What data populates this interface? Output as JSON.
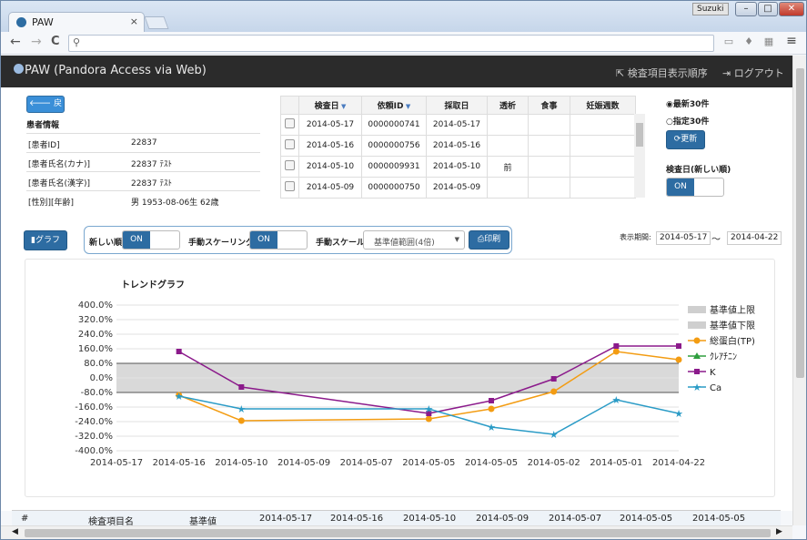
{
  "browser": {
    "tab_title": "PAW",
    "user": "Suzuki",
    "new_tab": "",
    "min": "–",
    "max": "□",
    "close": "✕",
    "tab_close": "×"
  },
  "toolbar": {
    "back": "←",
    "forward": "→",
    "reload": "C",
    "url": "",
    "menu": "≡"
  },
  "app": {
    "title": "PAW (Pandora Access via Web)",
    "order_link": "検査項目表示順序",
    "logout": "ログアウト"
  },
  "patient": {
    "back_label": "戻る",
    "heading": "患者情報",
    "rows": [
      {
        "k": "[患者ID]",
        "v": "22837"
      },
      {
        "k": "[患者氏名(カナ)]",
        "v": "22837 ﾃｽﾄ"
      },
      {
        "k": "[患者氏名(漢字)]",
        "v": "22837 ﾃｽﾄ"
      },
      {
        "k": "[性別][年齢]",
        "v": "男 1953-08-06生 62歳"
      }
    ]
  },
  "results": {
    "headers": [
      "",
      "検査日",
      "依頼ID",
      "採取日",
      "透析",
      "食事",
      "妊娠週数"
    ],
    "rows": [
      [
        "",
        "2014-05-17",
        "0000000741",
        "2014-05-17",
        "",
        "",
        ""
      ],
      [
        "",
        "2014-05-16",
        "0000000756",
        "2014-05-16",
        "",
        "",
        ""
      ],
      [
        "",
        "2014-05-10",
        "0000009931",
        "2014-05-10",
        "前",
        "",
        ""
      ],
      [
        "",
        "2014-05-09",
        "0000000750",
        "2014-05-09",
        "",
        "",
        ""
      ]
    ]
  },
  "side": {
    "radio_latest": "最新30件",
    "radio_range": "指定30件",
    "update": "更新",
    "sort_label": "検査日(新しい順)",
    "on": "ON"
  },
  "controls": {
    "graph_btn": "グラフ",
    "newest_first": "新しい順",
    "manual_scaling": "手動スケーリング",
    "manual_scale": "手動スケール",
    "scale_value": "基準値範囲(4倍)",
    "print": "印刷",
    "on": "ON",
    "period_label": "表示期間:",
    "period_from": "2014-05-17",
    "period_sep": "〜",
    "period_to": "2014-04-22"
  },
  "chart_data": {
    "type": "line",
    "title": "トレンドグラフ",
    "categories": [
      "2014-05-17",
      "2014-05-16",
      "2014-05-10",
      "2014-05-09",
      "2014-05-07",
      "2014-05-05",
      "2014-05-05",
      "2014-05-02",
      "2014-05-01",
      "2014-04-22"
    ],
    "ylim": [
      -400,
      400
    ],
    "yticks": [
      "400.0%",
      "320.0%",
      "240.0%",
      "160.0%",
      "80.0%",
      "0.0%",
      "-80.0%",
      "-160.0%",
      "-240.0%",
      "-320.0%",
      "-400.0%"
    ],
    "band": [
      -80,
      80
    ],
    "legend": [
      "基準値上限",
      "基準値下限",
      "総蛋白(TP)",
      "ｸﾚｱﾁﾆﾝ",
      "K",
      "Ca"
    ],
    "series": [
      {
        "name": "総蛋白(TP)",
        "color": "#f39c12",
        "marker": "circle",
        "values": [
          null,
          -95,
          -235,
          null,
          null,
          -225,
          -170,
          -75,
          145,
          100
        ]
      },
      {
        "name": "ｸﾚｱﾁﾆﾝ",
        "color": "#2e9e3e",
        "marker": "triangle",
        "values": [
          null,
          null,
          null,
          null,
          null,
          null,
          null,
          null,
          null,
          null
        ]
      },
      {
        "name": "K",
        "color": "#8b1a8b",
        "marker": "square",
        "values": [
          null,
          145,
          -50,
          null,
          null,
          -195,
          -125,
          -5,
          175,
          175
        ]
      },
      {
        "name": "Ca",
        "color": "#2a9bc6",
        "marker": "star",
        "values": [
          null,
          -100,
          -170,
          null,
          null,
          -170,
          -270,
          -310,
          -120,
          -195
        ]
      }
    ]
  },
  "bottom_table": {
    "headers": [
      "#",
      "検査項目名",
      "基準値",
      "2014-05-17",
      "2014-05-16",
      "2014-05-10",
      "2014-05-09",
      "2014-05-07",
      "2014-05-05",
      "2014-05-05"
    ]
  }
}
